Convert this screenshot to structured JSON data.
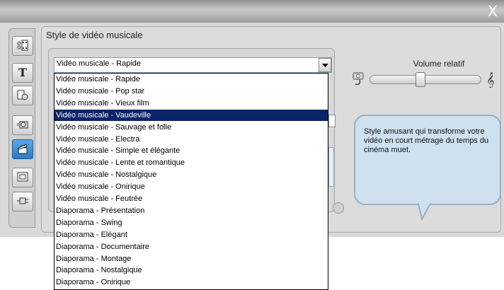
{
  "window": {
    "close_label": "X"
  },
  "panel": {
    "title": "Style de vidéo musicale"
  },
  "style_combo": {
    "value": "Vidéo musicale - Rapide",
    "options": [
      "Vidéo musicale - Rapide",
      "Vidéo musicale - Pop star",
      "Vidéo musicale - Vieux film",
      "Vidéo musicale - Vaudeville",
      "Vidéo musicale - Sauvage et folle",
      "Vidéo musicale - Electra",
      "Vidéo musicale - Simple et élégante",
      "Vidéo musicale - Lente et romantique",
      "Vidéo musicale - Nostalgique",
      "Vidéo musicale - Onirique",
      "Vidéo musicale - Feutrée",
      "Diaporama - Présentation",
      "Diaporama - Swing",
      "Diaporama - Elégant",
      "Diaporama - Documentaire",
      "Diaporama - Montage",
      "Diaporama - Nostalgique",
      "Diaporama - Onirique"
    ],
    "highlighted_index": 3
  },
  "volume": {
    "label": "Volume relatif",
    "level": 0.45
  },
  "description": "Style amusant qui transforme votre vidéo en court métrage du temps du cinéma muet.",
  "tools": [
    {
      "icon": "movie-edit-icon"
    },
    {
      "icon": "title-text-icon"
    },
    {
      "icon": "sound-effects-icon"
    },
    {
      "icon": "camera-icon"
    },
    {
      "icon": "smartmovie-icon"
    },
    {
      "icon": "menu-icon"
    },
    {
      "icon": "plugin-icon"
    }
  ],
  "colors": {
    "selection": "#0a246a",
    "bubble": "#cfe0ee"
  }
}
